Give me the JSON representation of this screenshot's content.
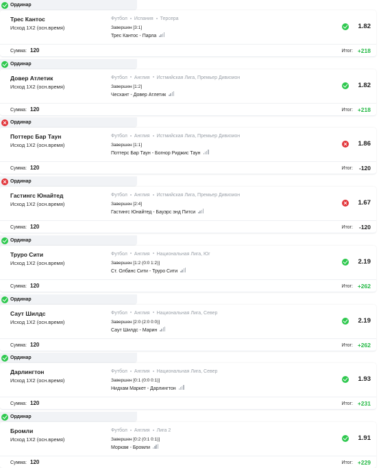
{
  "colors": {
    "win": "#2ec84e",
    "loss": "#e2363b",
    "profit": "#22b843",
    "muted": "#9aa0a8"
  },
  "labels": {
    "stake": "Сумма:",
    "total": "Итог:"
  },
  "bets": [
    {
      "type": "Ординар",
      "status": "win",
      "status_icon": "check-icon",
      "pick": "Трес Кантос",
      "market": "Исход 1Х2 (осн.время)",
      "breadcrumb": [
        "Футбол",
        "Испания",
        "Терсера"
      ],
      "result": "Завершен [3:1]",
      "match": "Трес Кантос - Парла",
      "odds": "1.82",
      "stake": "120",
      "total": "+218"
    },
    {
      "type": "Ординар",
      "status": "win",
      "status_icon": "check-icon",
      "pick": "Довер Атлетик",
      "market": "Исход 1Х2 (осн.время)",
      "breadcrumb": [
        "Футбол",
        "Англия",
        "Истмийская Лига, Премьер Дивизион"
      ],
      "result": "Завершен [1:2]",
      "match": "Чесхант - Довер Атлетик",
      "odds": "1.82",
      "stake": "120",
      "total": "+218"
    },
    {
      "type": "Ординар",
      "status": "loss",
      "status_icon": "cross-icon",
      "pick": "Поттерс Бар Таун",
      "market": "Исход 1Х2 (осн.время)",
      "breadcrumb": [
        "Футбол",
        "Англия",
        "Истмийская Лига, Премьер Дивизион"
      ],
      "result": "Завершен [1:1]",
      "match": "Поттерс Бар Таун - Богнор Риджис Таун",
      "odds": "1.86",
      "stake": "120",
      "total": "-120"
    },
    {
      "type": "Ординар",
      "status": "loss",
      "status_icon": "cross-icon",
      "pick": "Гастингс Юнайтед",
      "market": "Исход 1Х2 (осн.время)",
      "breadcrumb": [
        "Футбол",
        "Англия",
        "Истмийская Лига, Премьер Дивизион"
      ],
      "result": "Завершен [2:4]",
      "match": "Гастингс Юнайтед - Бауэрс энд Питси",
      "odds": "1.67",
      "stake": "120",
      "total": "-120"
    },
    {
      "type": "Ординар",
      "status": "win",
      "status_icon": "check-icon",
      "pick": "Труро Сити",
      "market": "Исход 1Х2 (осн.время)",
      "breadcrumb": [
        "Футбол",
        "Англия",
        "Национальная Лига, Юг"
      ],
      "result": "Завершен [1:2 (0:0 1:2)]",
      "match": "Ст. Олбанс Сити - Труро Сити",
      "odds": "2.19",
      "stake": "120",
      "total": "+262"
    },
    {
      "type": "Ординар",
      "status": "win",
      "status_icon": "check-icon",
      "pick": "Саут Шилдс",
      "market": "Исход 1Х2 (осн.время)",
      "breadcrumb": [
        "Футбол",
        "Англия",
        "Национальная Лига, Север"
      ],
      "result": "Завершен [2:0 (2:0 0:0)]",
      "match": "Саут Шилдс - Марин",
      "odds": "2.19",
      "stake": "120",
      "total": "+262"
    },
    {
      "type": "Ординар",
      "status": "win",
      "status_icon": "check-icon",
      "pick": "Дарлингтон",
      "market": "Исход 1Х2 (осн.время)",
      "breadcrumb": [
        "Футбол",
        "Англия",
        "Национальная Лига, Север"
      ],
      "result": "Завершен [0:1 (0:0 0:1)]",
      "match": "Нидхам Маркет - Дарлингтон",
      "odds": "1.93",
      "stake": "120",
      "total": "+231"
    },
    {
      "type": "Ординар",
      "status": "win",
      "status_icon": "check-icon",
      "pick": "Бромли",
      "market": "Исход 1Х2 (осн.время)",
      "breadcrumb": [
        "Футбол",
        "Англия",
        "Лига 2"
      ],
      "result": "Завершен [0:2 (0:1 0:1)]",
      "match": "Моркам - Бромли",
      "odds": "1.91",
      "stake": "120",
      "total": "+229"
    }
  ]
}
